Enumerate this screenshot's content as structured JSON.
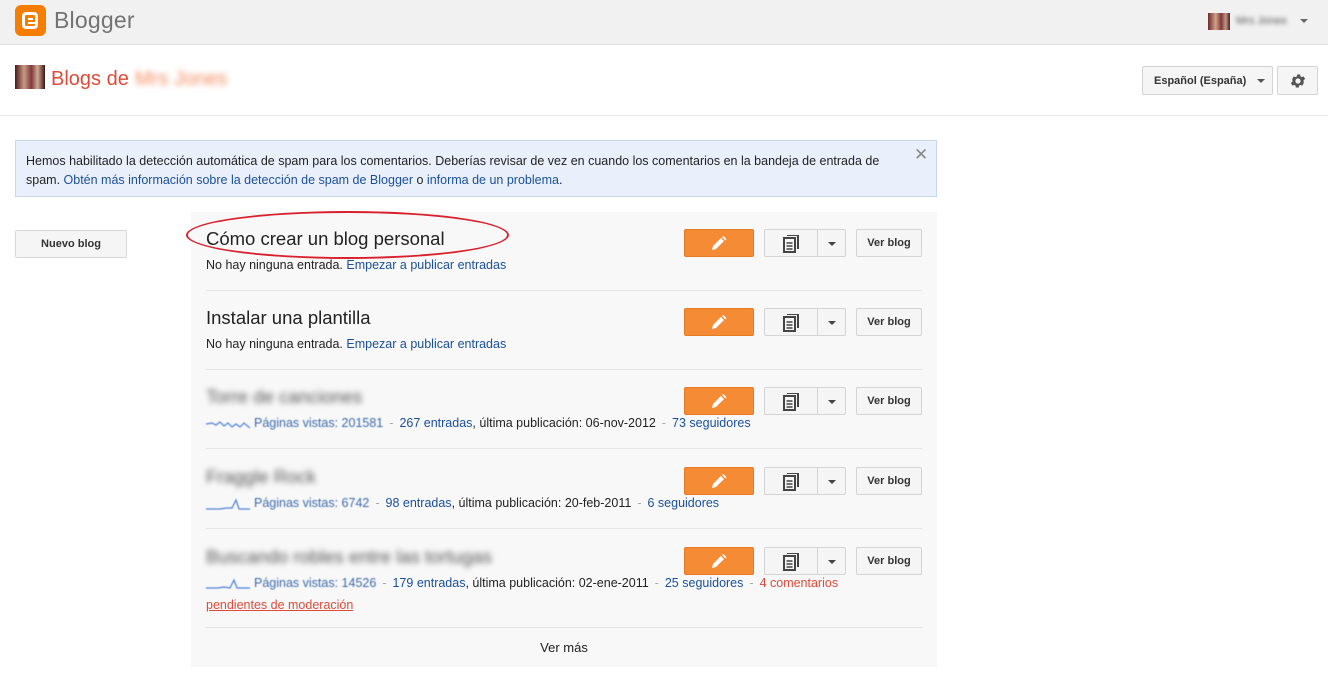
{
  "app": {
    "logo_text": "Blogger",
    "user_name": "Mrs Jones"
  },
  "header": {
    "title": "Blogs de",
    "owner": "Mrs Jones",
    "language": "Español (España)"
  },
  "notice": {
    "text_1": "Hemos habilitado la detección automática de spam para los comentarios. Deberías revisar de vez en cuando los comentarios en la bandeja de entrada de spam. ",
    "link_1": "Obtén más información sobre la detección de spam de Blogger",
    "text_2": " o ",
    "link_2": "informa de un problema",
    "text_3": ".",
    "close": "✕"
  },
  "new_blog_label": "Nuevo blog",
  "view_blog_label": "Ver blog",
  "blogs": [
    {
      "title": "Cómo crear un blog personal",
      "no_posts": "No hay ninguna entrada.",
      "start_link": "Empezar a publicar entradas"
    },
    {
      "title": "Instalar una plantilla",
      "no_posts": "No hay ninguna entrada.",
      "start_link": "Empezar a publicar entradas"
    },
    {
      "title": "Torre de canciones",
      "pageviews": "Páginas vistas: 201581",
      "posts": "267 entradas",
      "last": ", última publicación: 06-nov-2012",
      "followers": "73 seguidores"
    },
    {
      "title": "Fraggle Rock",
      "pageviews": "Páginas vistas: 6742",
      "posts": "98 entradas",
      "last": ", última publicación: 20-feb-2011",
      "followers": "6 seguidores"
    },
    {
      "title": "Buscando robles entre las tortugas",
      "pageviews": "Páginas vistas: 14526",
      "posts": "179 entradas",
      "last": ", última publicación: 02-ene-2011",
      "followers": "25 seguidores",
      "pending_a": "4 comentarios",
      "pending_b": "pendientes de moderación"
    }
  ],
  "see_more": "Ver más",
  "colors": {
    "accent": "#f57d00",
    "edit_button": "#f58b35",
    "link": "#1a4f9c",
    "title_red": "#dd4b39",
    "highlight": "#d8212d"
  }
}
